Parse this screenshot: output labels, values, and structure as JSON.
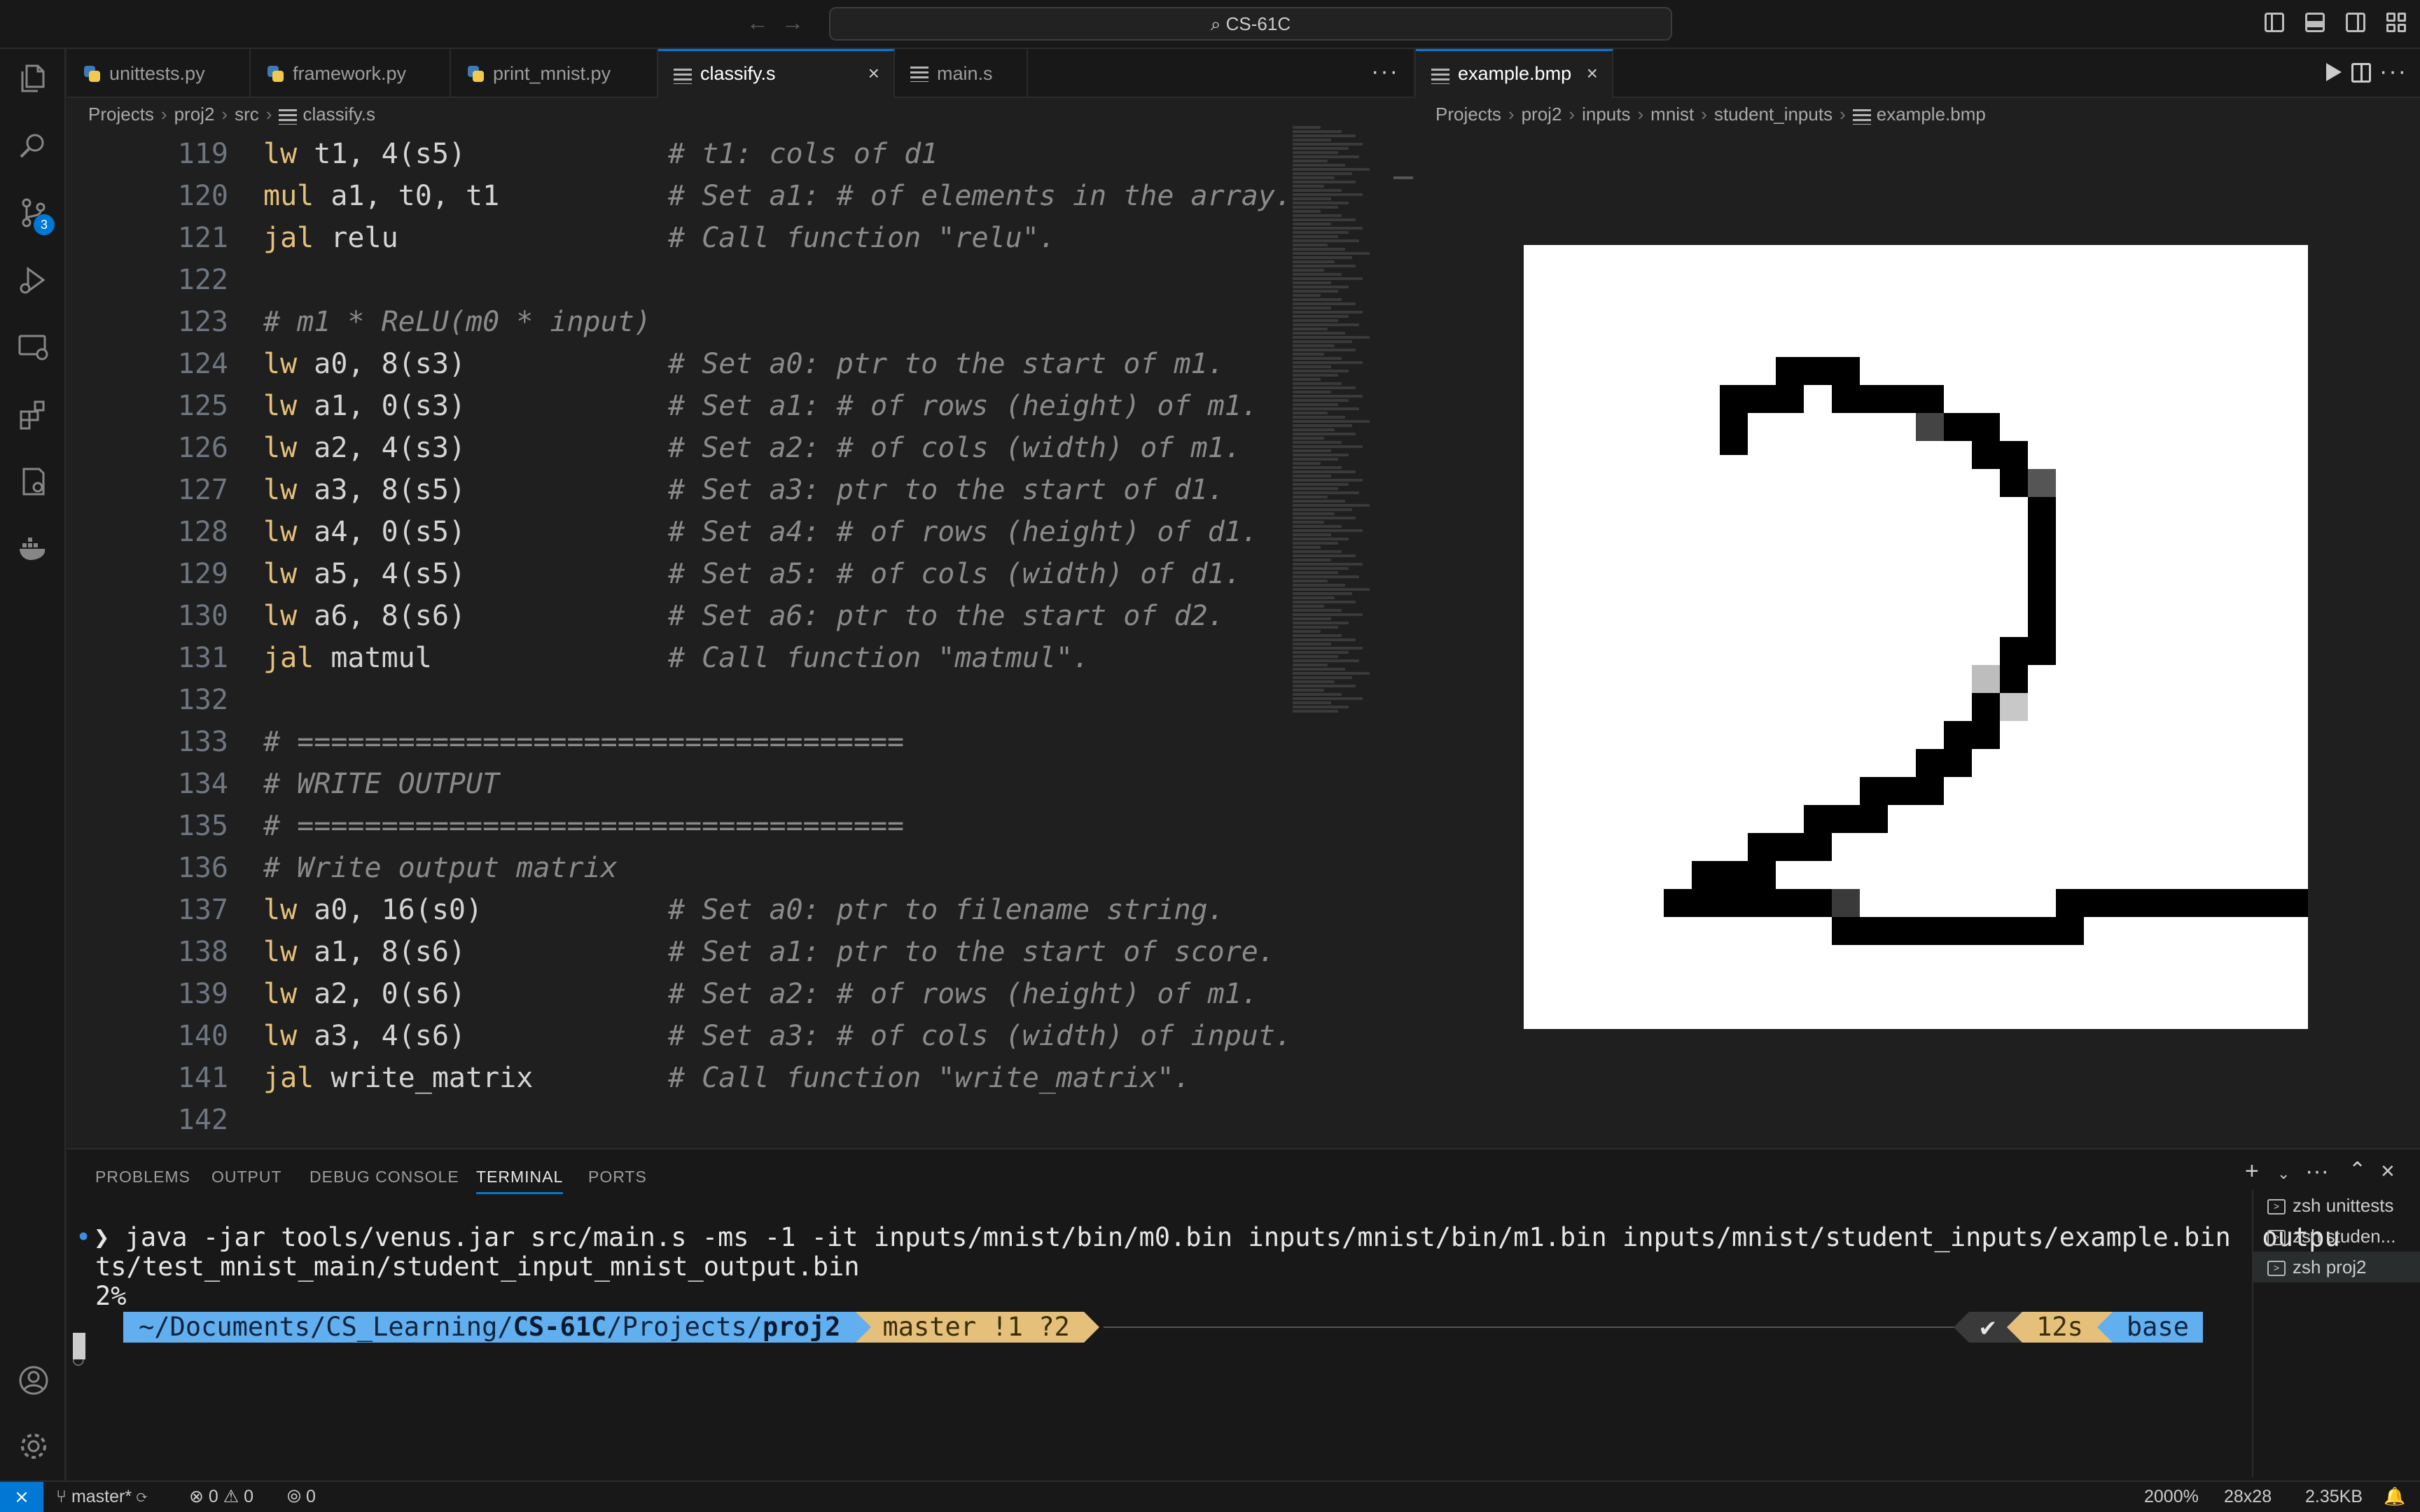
{
  "titlebar": {
    "search_text": "⌕ CS-61C"
  },
  "activity": {
    "scm_badge": "3"
  },
  "editor_left": {
    "tabs": [
      {
        "label": "unittests.py",
        "icon": "python-icon"
      },
      {
        "label": "framework.py",
        "icon": "python-icon"
      },
      {
        "label": "print_mnist.py",
        "icon": "python-icon"
      },
      {
        "label": "classify.s",
        "icon": "assembly-file-icon",
        "active": true
      },
      {
        "label": "main.s",
        "icon": "assembly-file-icon"
      }
    ],
    "breadcrumb": [
      "Projects",
      "proj2",
      "src",
      "classify.s"
    ],
    "lines": [
      {
        "n": "119",
        "code": "lw t1, 4(s5)",
        "comment": "# t1: cols of d1"
      },
      {
        "n": "120",
        "code": "mul a1, t0, t1",
        "comment": "# Set a1: # of elements in the array."
      },
      {
        "n": "121",
        "code": "jal relu",
        "comment": "# Call function \"relu\"."
      },
      {
        "n": "122",
        "code": "",
        "comment": ""
      },
      {
        "n": "123",
        "code": "",
        "comment": "# m1 * ReLU(m0 * input)"
      },
      {
        "n": "124",
        "code": "lw a0, 8(s3)",
        "comment": "# Set a0: ptr to the start of m1."
      },
      {
        "n": "125",
        "code": "lw a1, 0(s3)",
        "comment": "# Set a1: # of rows (height) of m1."
      },
      {
        "n": "126",
        "code": "lw a2, 4(s3)",
        "comment": "# Set a2: # of cols (width) of m1."
      },
      {
        "n": "127",
        "code": "lw a3, 8(s5)",
        "comment": "# Set a3: ptr to the start of d1."
      },
      {
        "n": "128",
        "code": "lw a4, 0(s5)",
        "comment": "# Set a4: # of rows (height) of d1."
      },
      {
        "n": "129",
        "code": "lw a5, 4(s5)",
        "comment": "# Set a5: # of cols (width) of d1."
      },
      {
        "n": "130",
        "code": "lw a6, 8(s6)",
        "comment": "# Set a6: ptr to the start of d2."
      },
      {
        "n": "131",
        "code": "jal matmul",
        "comment": "# Call function \"matmul\"."
      },
      {
        "n": "132",
        "code": "",
        "comment": ""
      },
      {
        "n": "133",
        "code": "",
        "comment": "# ===================================="
      },
      {
        "n": "134",
        "code": "",
        "comment": "# WRITE OUTPUT"
      },
      {
        "n": "135",
        "code": "",
        "comment": "# ===================================="
      },
      {
        "n": "136",
        "code": "",
        "comment": "# Write output matrix"
      },
      {
        "n": "137",
        "code": "lw a0, 16(s0)",
        "comment": "# Set a0: ptr to filename string."
      },
      {
        "n": "138",
        "code": "lw a1, 8(s6)",
        "comment": "# Set a1: ptr to the start of score."
      },
      {
        "n": "139",
        "code": "lw a2, 0(s6)",
        "comment": "# Set a2: # of rows (height) of m1."
      },
      {
        "n": "140",
        "code": "lw a3, 4(s6)",
        "comment": "# Set a3: # of cols (width) of input."
      },
      {
        "n": "141",
        "code": "jal write_matrix",
        "comment": "# Call function \"write_matrix\"."
      },
      {
        "n": "142",
        "code": "",
        "comment": ""
      }
    ]
  },
  "editor_right": {
    "tab": {
      "label": "example.bmp",
      "icon": "image-file-icon"
    },
    "breadcrumb": [
      "Projects",
      "proj2",
      "inputs",
      "mnist",
      "student_inputs",
      "example.bmp"
    ],
    "image_alt": "28x28 grayscale bitmap of a handwritten digit 2"
  },
  "panel": {
    "tabs": [
      "PROBLEMS",
      "OUTPUT",
      "DEBUG CONSOLE",
      "TERMINAL",
      "PORTS"
    ],
    "active_tab": "TERMINAL",
    "terminal": {
      "command_line1": "❯ java -jar tools/venus.jar src/main.s -ms -1 -it inputs/mnist/bin/m0.bin inputs/mnist/bin/m1.bin inputs/mnist/student_inputs/example.bin  outpu",
      "command_line2": "ts/test_mnist_main/student_input_mnist_output.bin",
      "output_line": "2%",
      "prompt_path_prefix": "~/Documents/CS_Learning/",
      "prompt_path_bold1": "CS-61C",
      "prompt_path_mid": "/Projects/",
      "prompt_path_bold2": "proj2",
      "prompt_git": "master !1 ?2",
      "prompt_status": "✔",
      "prompt_time": "12s",
      "prompt_env": "base "
    },
    "terminals": [
      {
        "shell": "zsh",
        "name": "unittests"
      },
      {
        "shell": "zsh",
        "name": "studen..."
      },
      {
        "shell": "zsh",
        "name": "proj2",
        "active": true
      }
    ]
  },
  "statusbar": {
    "remote": "⨯",
    "branch": "master*",
    "errors": "0",
    "warnings": "0",
    "ports": "0",
    "zoom": "2000%",
    "dimensions": "28x28",
    "size": "2.35KB"
  },
  "colors": {
    "accent": "#0078d4",
    "keyword": "#e5c07b",
    "comment": "#8a8a8a",
    "prompt_path": "#61afef",
    "prompt_git": "#e5c07b"
  }
}
